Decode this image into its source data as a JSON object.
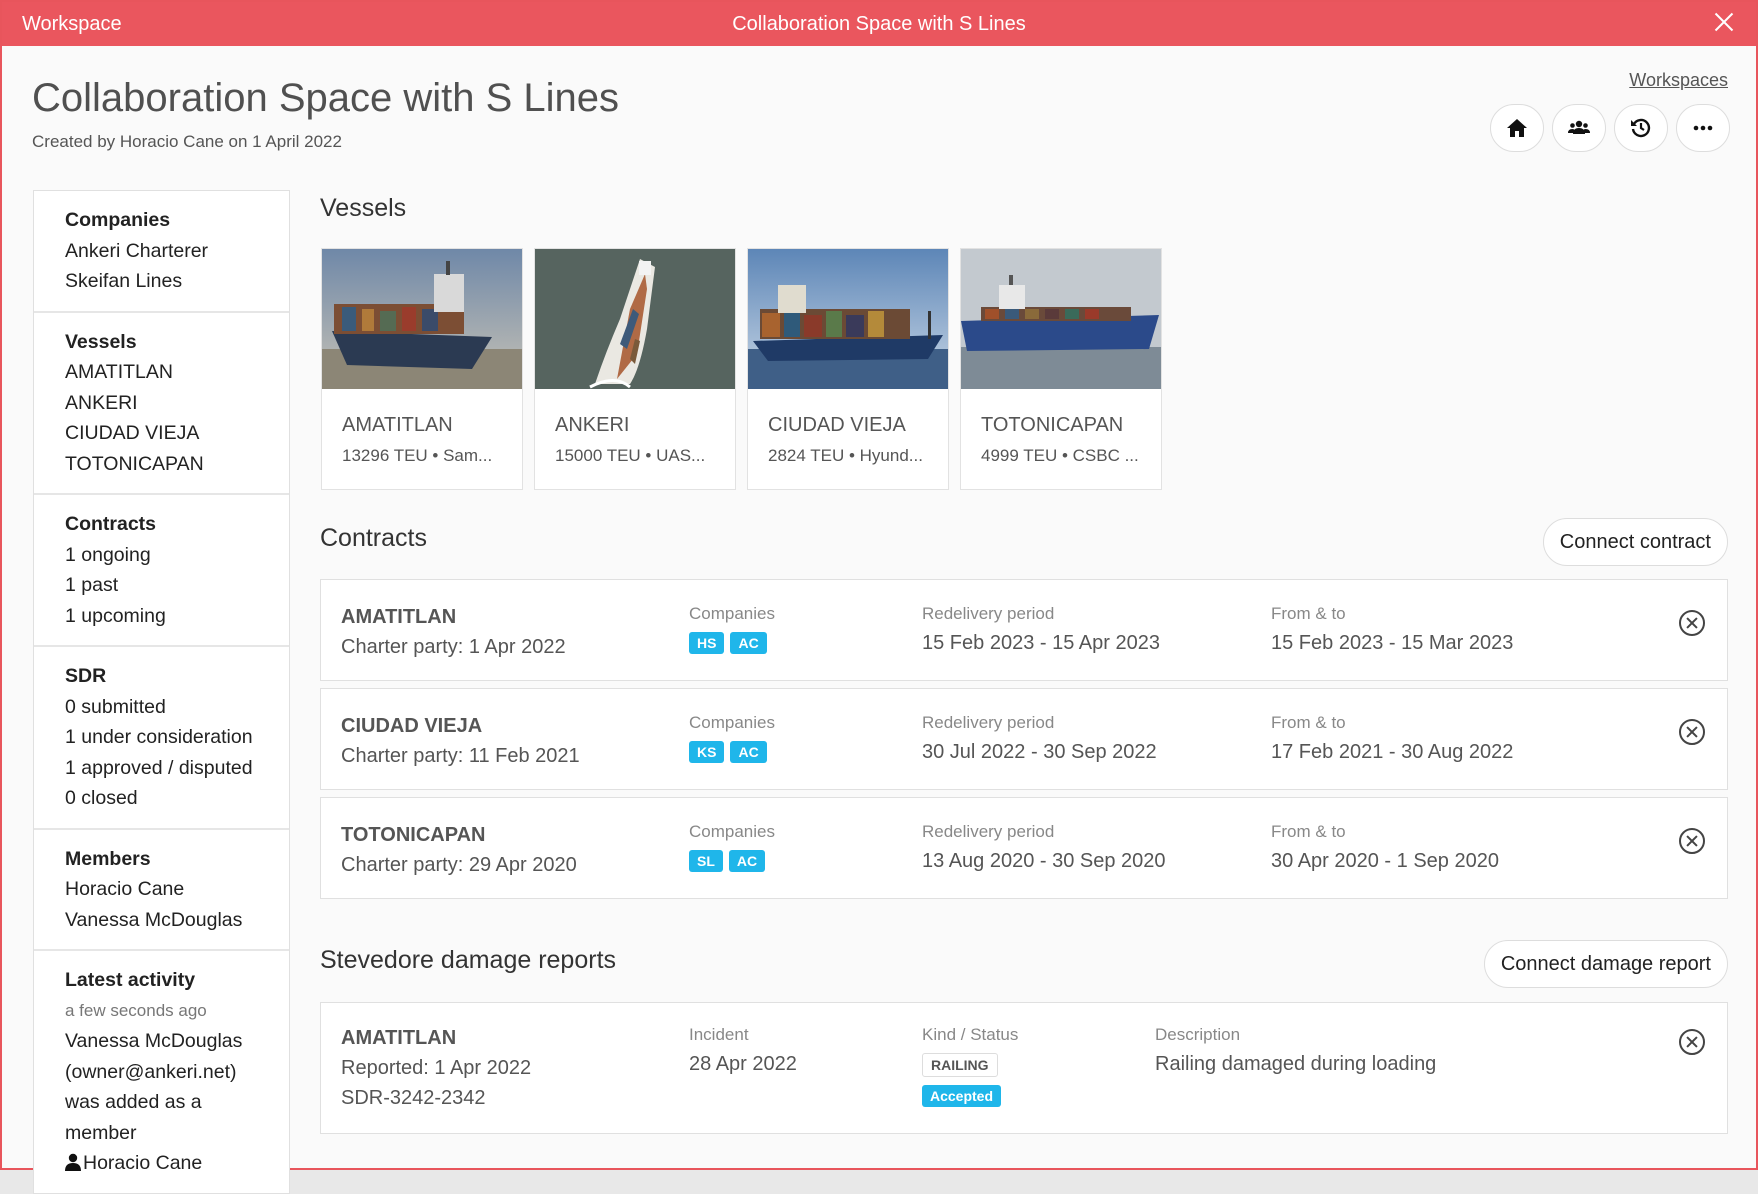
{
  "window": {
    "app_label": "Workspace",
    "title": "Collaboration Space with S Lines"
  },
  "header": {
    "title": "Collaboration Space with S Lines",
    "subtitle": "Created by Horacio Cane on 1 April 2022",
    "workspaces_link": "Workspaces",
    "icons": [
      "home-icon",
      "users-icon",
      "history-icon",
      "more-icon"
    ]
  },
  "sidebar": {
    "companies": {
      "title": "Companies",
      "items": [
        "Ankeri Charterer",
        "Skeifan Lines"
      ]
    },
    "vessels": {
      "title": "Vessels",
      "items": [
        "AMATITLAN",
        "ANKERI",
        "CIUDAD VIEJA",
        "TOTONICAPAN"
      ]
    },
    "contracts": {
      "title": "Contracts",
      "items": [
        "1 ongoing",
        "1 past",
        "1 upcoming"
      ]
    },
    "sdr": {
      "title": "SDR",
      "items": [
        "0 submitted",
        "1 under consideration",
        "1 approved / disputed",
        "0 closed"
      ]
    },
    "members": {
      "title": "Members",
      "items": [
        "Horacio Cane",
        "Vanessa McDouglas"
      ]
    },
    "activity": {
      "title": "Latest activity",
      "time": "a few seconds ago",
      "lines": [
        "Vanessa McDouglas",
        "(owner@ankeri.net)",
        "was added as a",
        "member"
      ],
      "by": "Horacio Cane"
    }
  },
  "vessels": {
    "title": "Vessels",
    "items": [
      {
        "name": "AMATITLAN",
        "info": "13296 TEU • Sam..."
      },
      {
        "name": "ANKERI",
        "info": "15000 TEU • UAS..."
      },
      {
        "name": "CIUDAD VIEJA",
        "info": "2824 TEU • Hyund..."
      },
      {
        "name": "TOTONICAPAN",
        "info": "4999 TEU • CSBC ..."
      }
    ]
  },
  "contracts": {
    "title": "Contracts",
    "connect_label": "Connect contract",
    "labels": {
      "companies": "Companies",
      "redelivery": "Redelivery period",
      "fromto": "From & to"
    },
    "items": [
      {
        "vessel": "AMATITLAN",
        "party": "Charter party: 1 Apr 2022",
        "companies": [
          "HS",
          "AC"
        ],
        "redelivery": "15 Feb 2023 - 15 Apr 2023",
        "fromto": "15 Feb 2023 - 15 Mar 2023"
      },
      {
        "vessel": "CIUDAD VIEJA",
        "party": "Charter party: 11 Feb 2021",
        "companies": [
          "KS",
          "AC"
        ],
        "redelivery": "30 Jul 2022 - 30 Sep 2022",
        "fromto": "17 Feb 2021 - 30 Aug 2022"
      },
      {
        "vessel": "TOTONICAPAN",
        "party": "Charter party: 29 Apr 2020",
        "companies": [
          "SL",
          "AC"
        ],
        "redelivery": "13 Aug 2020 - 30 Sep 2020",
        "fromto": "30 Apr 2020 - 1 Sep 2020"
      }
    ]
  },
  "damage": {
    "title": "Stevedore damage reports",
    "connect_label": "Connect damage report",
    "labels": {
      "incident": "Incident",
      "kind": "Kind / Status",
      "description": "Description"
    },
    "item": {
      "vessel": "AMATITLAN",
      "reported": "Reported: 1 Apr 2022",
      "ref": "SDR-3242-2342",
      "incident": "28 Apr 2022",
      "kind": "RAILING",
      "status": "Accepted",
      "description": "Railing damaged during loading"
    }
  },
  "colors": {
    "accent": "#ea565e",
    "badge": "#1fb6ea"
  }
}
